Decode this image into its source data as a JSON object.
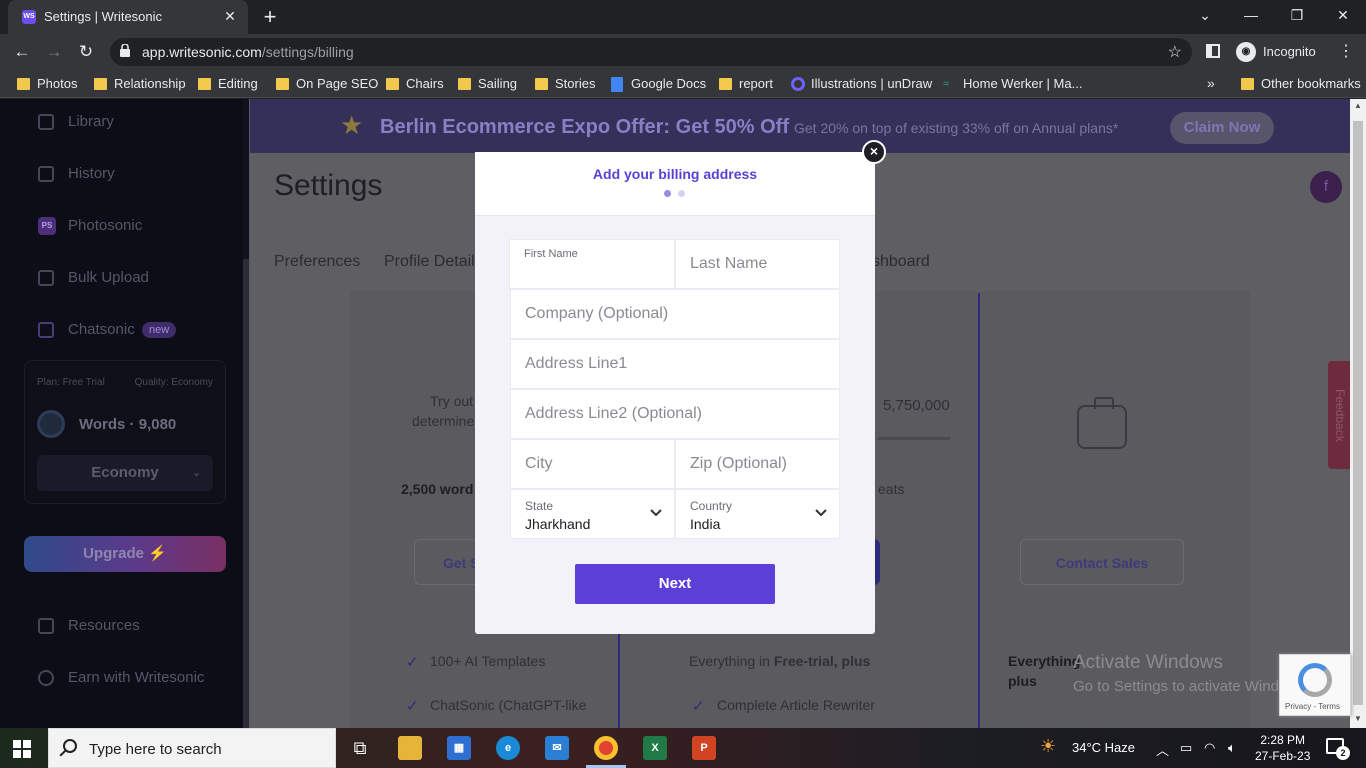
{
  "browser": {
    "tab_title": "Settings | Writesonic",
    "favicon_text": "WS",
    "url_domain": "app.writesonic.com",
    "url_path": "/settings/billing",
    "profile_label": "Incognito"
  },
  "bookmarks": {
    "items": [
      {
        "label": "Photos",
        "icon": "folder-icon"
      },
      {
        "label": "Relationship",
        "icon": "folder-icon"
      },
      {
        "label": "Editing",
        "icon": "folder-icon"
      },
      {
        "label": "On Page SEO",
        "icon": "folder-icon"
      },
      {
        "label": "Chairs",
        "icon": "folder-icon"
      },
      {
        "label": "Sailing",
        "icon": "folder-icon"
      },
      {
        "label": "Stories",
        "icon": "folder-icon"
      },
      {
        "label": "Google Docs",
        "icon": "google-docs-icon"
      },
      {
        "label": "report",
        "icon": "folder-icon"
      },
      {
        "label": "Illustrations | unDraw",
        "icon": "undraw-icon"
      },
      {
        "label": "Home Werker | Ma...",
        "icon": "home-werker-icon"
      }
    ],
    "more": "»",
    "other": "Other bookmarks"
  },
  "sidebar": {
    "items": [
      {
        "label": "Library"
      },
      {
        "label": "History"
      },
      {
        "label": "Photosonic",
        "icon_text": "PS"
      },
      {
        "label": "Bulk Upload"
      },
      {
        "label": "Chatsonic",
        "badge": "new"
      },
      {
        "label": "Resources"
      },
      {
        "label": "Earn with Writesonic"
      }
    ],
    "plan_label": "Plan: Free Trial",
    "quality_label": "Quality: Economy",
    "words_label": "Words · 9,080",
    "quality_select": "Economy",
    "upgrade_label": "Upgrade"
  },
  "promo": {
    "headline": "Berlin Ecommerce Expo Offer: Get 50% Off",
    "sub": "Get 20% on top of existing 33% off on Annual plans*",
    "cta": "Claim Now"
  },
  "settings": {
    "title": "Settings",
    "avatar_letter": "f",
    "tabs": [
      "Preferences",
      "Profile Detail",
      "shboard"
    ]
  },
  "cards": {
    "try_out_1": "Try out",
    "try_out_2": "determine",
    "words_free": "2,500 word",
    "words_big": "5,750,000",
    "seats": "eats",
    "get_started": "Get S",
    "contact_sales": "Contact Sales",
    "feature_1": "100+ AI Templates",
    "feature_2": "ChatSonic (ChatGPT-like",
    "everything_free": "Everything in ",
    "everything_free_bold": "Free-trial, plus",
    "article_rewriter": "Complete Article Rewriter",
    "everything_ent_1": "Everything",
    "everything_ent_2": "plus",
    "feedback": "Feedback"
  },
  "modal": {
    "title": "Add your billing address",
    "first_name_label": "First Name",
    "last_name_placeholder": "Last Name",
    "company_placeholder": "Company (Optional)",
    "address1_placeholder": "Address Line1",
    "address2_placeholder": "Address Line2 (Optional)",
    "city_placeholder": "City",
    "zip_placeholder": "Zip (Optional)",
    "state_label": "State",
    "state_value": "Jharkhand",
    "country_label": "Country",
    "country_value": "India",
    "next_label": "Next",
    "close_glyph": "×",
    "step_total": 2,
    "step_current": 1
  },
  "overlay": {
    "activate_line1": "Activate Windows",
    "activate_line2": "Go to Settings to activate Windows.",
    "recaptcha_terms": "Privacy - Terms"
  },
  "taskbar": {
    "search_placeholder": "Type here to search",
    "weather": "34°C  Haze",
    "time": "2:28 PM",
    "date": "27-Feb-23",
    "notification_count": "2"
  },
  "colors": {
    "accent": "#5b3fd6",
    "promo_bg": "#35305a",
    "sidebar_bg": "#0c0d16"
  }
}
